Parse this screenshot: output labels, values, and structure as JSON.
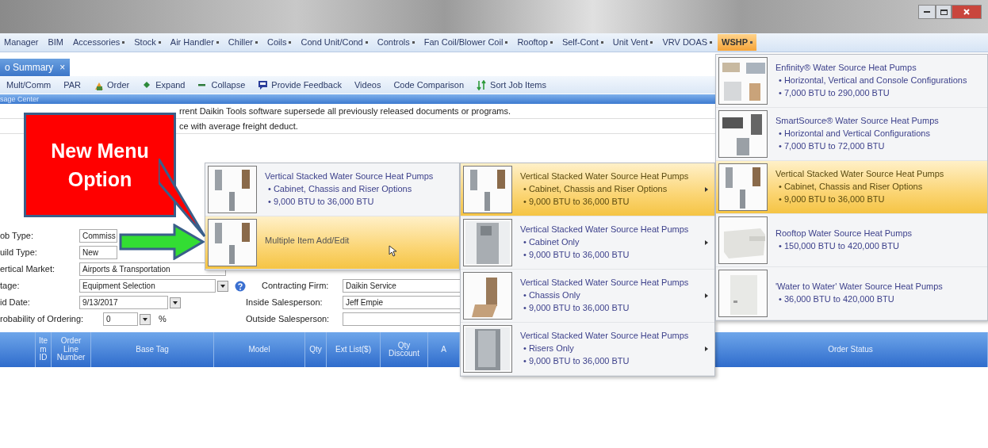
{
  "menu_bar": [
    {
      "label": "Manager",
      "dropdown": false,
      "selected": false
    },
    {
      "label": "BIM",
      "dropdown": false,
      "selected": false
    },
    {
      "label": "Accessories",
      "dropdown": true,
      "selected": false
    },
    {
      "label": "Stock",
      "dropdown": true,
      "selected": false
    },
    {
      "label": "Air Handler",
      "dropdown": true,
      "selected": false
    },
    {
      "label": "Chiller",
      "dropdown": true,
      "selected": false
    },
    {
      "label": "Coils",
      "dropdown": true,
      "selected": false
    },
    {
      "label": "Cond Unit/Cond",
      "dropdown": true,
      "selected": false
    },
    {
      "label": "Controls",
      "dropdown": true,
      "selected": false
    },
    {
      "label": "Fan Coil/Blower Coil",
      "dropdown": true,
      "selected": false
    },
    {
      "label": "Rooftop",
      "dropdown": true,
      "selected": false
    },
    {
      "label": "Self-Cont",
      "dropdown": true,
      "selected": false
    },
    {
      "label": "Unit Vent",
      "dropdown": true,
      "selected": false
    },
    {
      "label": "VRV DOAS",
      "dropdown": true,
      "selected": false
    },
    {
      "label": "WSHP",
      "dropdown": true,
      "selected": true
    }
  ],
  "tab": {
    "label": "o Summary",
    "close": "×"
  },
  "toolbar": [
    {
      "label": "Mult/Comm",
      "kind": "text"
    },
    {
      "label": "PAR",
      "kind": "text"
    },
    {
      "label": "Order",
      "kind": "order"
    },
    {
      "label": "Expand",
      "kind": "expand"
    },
    {
      "label": "Collapse",
      "kind": "collapse"
    },
    {
      "label": "Provide Feedback",
      "kind": "feedback"
    },
    {
      "label": "Videos",
      "kind": "text"
    },
    {
      "label": "Code Comparison",
      "kind": "text"
    },
    {
      "label": "Sort Job Items",
      "kind": "sort"
    }
  ],
  "message_center": {
    "title": "sage Center",
    "messages": [
      "rrent Daikin Tools software supersede all previously released documents or programs.",
      "ce with average freight deduct."
    ]
  },
  "form": {
    "left": [
      {
        "label": "ob Type:",
        "value": "Commiss"
      },
      {
        "label": "uild Type:",
        "value": "New"
      },
      {
        "label": "ertical Market:",
        "value": "Airports & Transportation"
      },
      {
        "label": "tage:",
        "value": "Equipment Selection",
        "dropdown": true,
        "help": true
      },
      {
        "label": "id Date:",
        "value": "9/13/2017",
        "dropdown": true
      },
      {
        "label": "robability of Ordering:",
        "value": "0",
        "dropdown": true,
        "unit": "%"
      }
    ],
    "right": [
      {
        "label": "Contracting Firm:",
        "value": "Daikin Service"
      },
      {
        "label": "Inside Salesperson:",
        "value": "Jeff Empie"
      },
      {
        "label": "Outside Salesperson:"
      }
    ]
  },
  "grid": {
    "columns": [
      "",
      "Ite m ID",
      "Order Line Number",
      "Base Tag",
      "Model",
      "Qty",
      "Ext List($)",
      "Qty Discount",
      "A",
      "",
      "Order Status"
    ]
  },
  "callout": {
    "text": "New Menu Option"
  },
  "menu_level_1": [
    {
      "kind": "product",
      "title": "Vertical Stacked  Water Source Heat Pumps",
      "bullets": [
        "• Cabinet, Chassis and Riser Options",
        "• 9,000 BTU to 36,000 BTU"
      ],
      "selected": false
    },
    {
      "kind": "action",
      "title": "Multiple Item Add/Edit",
      "selected": true
    }
  ],
  "menu_level_2": [
    {
      "kind": "product",
      "title": "Vertical Stacked  Water Source Heat Pumps",
      "bullets": [
        "• Cabinet, Chassis and Riser Options",
        "• 9,000 BTU to 36,000 BTU"
      ],
      "selected": true,
      "submenu": true
    },
    {
      "kind": "product",
      "title": "Vertical Stacked  Water Source Heat Pumps",
      "bullets": [
        "• Cabinet Only",
        "• 9,000 BTU to 36,000 BTU"
      ],
      "selected": false,
      "submenu": true
    },
    {
      "kind": "product",
      "title": "Vertical Stacked  Water Source Heat Pumps",
      "bullets": [
        "• Chassis Only",
        "• 9,000 BTU to 36,000 BTU"
      ],
      "selected": false,
      "submenu": true
    },
    {
      "kind": "product",
      "title": "Vertical Stacked  Water Source Heat Pumps",
      "bullets": [
        "• Risers Only",
        "• 9,000 BTU to 36,000 BTU"
      ],
      "selected": false,
      "submenu": true
    }
  ],
  "menu_level_3": [
    {
      "kind": "product",
      "title": "Enfinity®  Water Source Heat Pumps",
      "bullets": [
        "• Horizontal, Vertical and Console Configurations",
        "• 7,000 BTU to 290,000 BTU"
      ],
      "selected": false
    },
    {
      "kind": "product",
      "title": "SmartSource®  Water Source Heat Pumps",
      "bullets": [
        "• Horizontal and Vertical Configurations",
        "• 7,000 BTU to 72,000 BTU"
      ],
      "selected": false
    },
    {
      "kind": "product",
      "title": "Vertical Stacked  Water Source Heat Pumps",
      "bullets": [
        "• Cabinet, Chassis and Riser Options",
        "• 9,000 BTU to 36,000 BTU"
      ],
      "selected": true
    },
    {
      "kind": "product",
      "title": "Rooftop Water Source Heat Pumps",
      "bullets": [
        "• 150,000 BTU to 420,000 BTU"
      ],
      "selected": false
    },
    {
      "kind": "product",
      "title": "'Water to Water' Water Source Heat Pumps",
      "bullets": [
        "• 36,000 BTU to 420,000 BTU"
      ],
      "selected": false
    }
  ]
}
